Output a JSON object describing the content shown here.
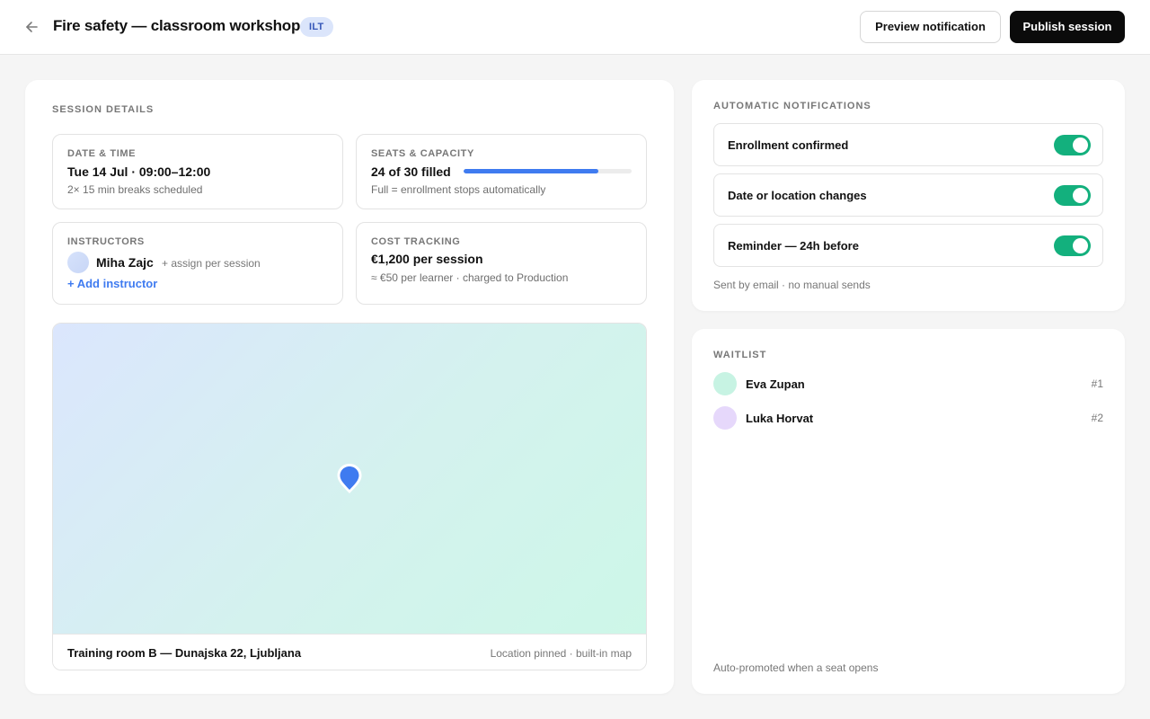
{
  "header": {
    "title": "Fire safety — classroom workshop",
    "badge": "ILT",
    "preview_label": "Preview notification",
    "publish_label": "Publish session"
  },
  "session": {
    "section_label": "SESSION DETAILS",
    "datetime": {
      "label": "DATE & TIME",
      "value": "Tue 14 Jul · 09:00–12:00",
      "sub": "2× 15 min breaks scheduled"
    },
    "seats": {
      "label": "SEATS & CAPACITY",
      "value": "24 of 30 filled",
      "filled": 24,
      "capacity": 30,
      "sub": "Full = enrollment stops automatically"
    },
    "instructors": {
      "label": "INSTRUCTORS",
      "name": "Miha Zajc",
      "hint": "+ assign per session",
      "add_label": "+ Add instructor"
    },
    "cost": {
      "label": "COST TRACKING",
      "value": "€1,200 per session",
      "sub": "≈ €50 per learner · charged to Production"
    },
    "location": {
      "address": "Training room B — Dunajska 22, Ljubljana",
      "note": "Location pinned · built-in map"
    }
  },
  "notifications": {
    "section_label": "AUTOMATIC NOTIFICATIONS",
    "items": [
      {
        "label": "Enrollment confirmed",
        "enabled": true
      },
      {
        "label": "Date or location changes",
        "enabled": true
      },
      {
        "label": "Reminder — 24h before",
        "enabled": true
      }
    ],
    "footnote": "Sent by email · no manual sends"
  },
  "waitlist": {
    "section_label": "WAITLIST",
    "entries": [
      {
        "name": "Eva Zupan",
        "rank": "#1",
        "avatar_color": "#c7f3e3"
      },
      {
        "name": "Luka Horvat",
        "rank": "#2",
        "avatar_color": "#e6d8fb"
      }
    ],
    "footnote": "Auto-promoted when a seat opens"
  },
  "colors": {
    "accent": "#3f7bf0",
    "toggle_on": "#13b07d",
    "primary_button": "#0b0b0b",
    "badge_bg": "#dbe5fb"
  }
}
